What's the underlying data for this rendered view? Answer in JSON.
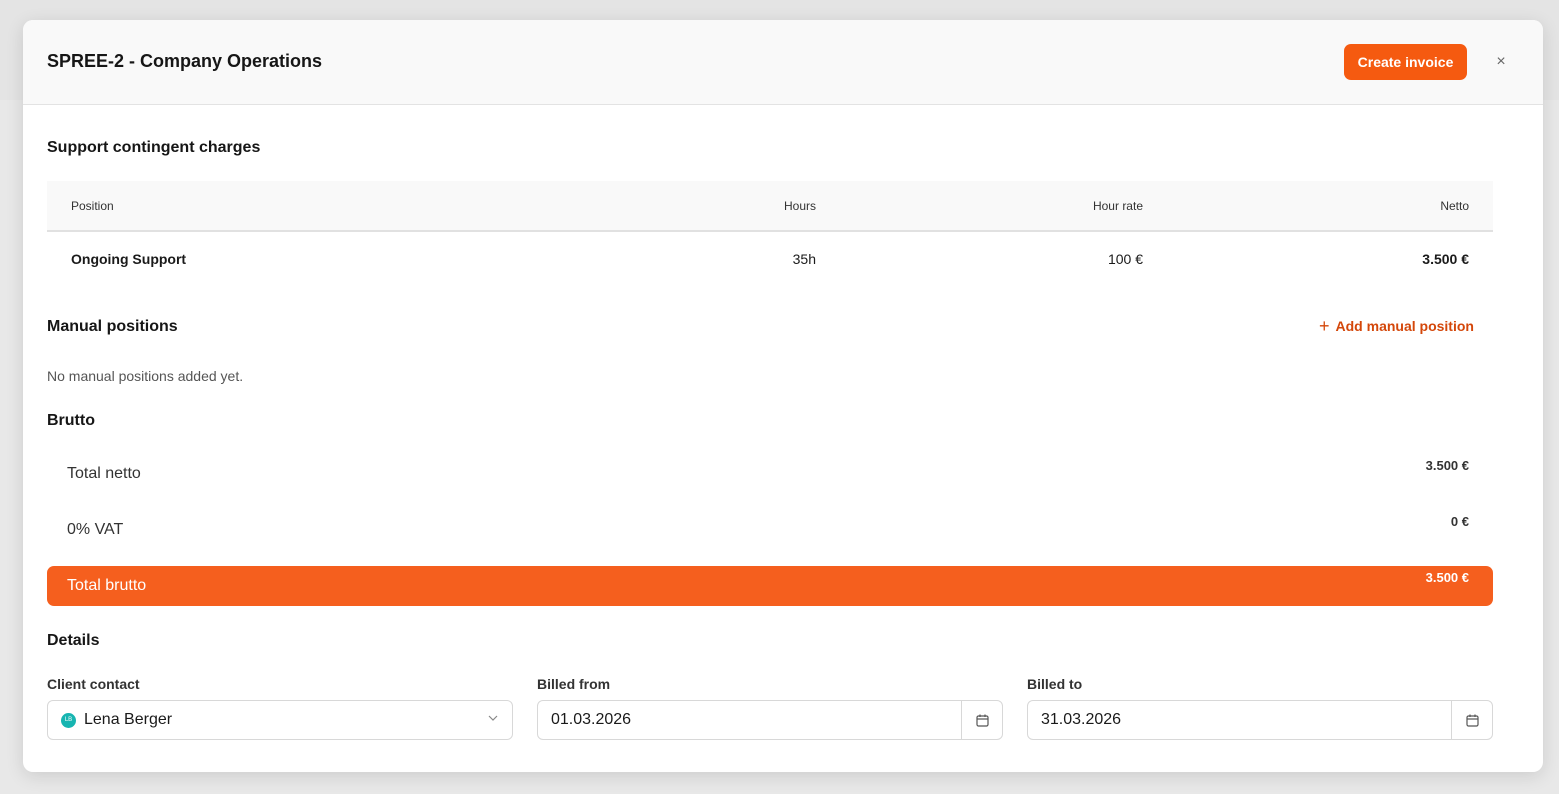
{
  "modal": {
    "title": "SPREE-2 - Company Operations",
    "create_invoice_label": "Create invoice",
    "close_label": "×"
  },
  "support": {
    "title": "Support contingent charges",
    "columns": [
      "Position",
      "Hours",
      "Hour rate",
      "Netto"
    ],
    "rows": [
      {
        "position": "Ongoing Support",
        "hours": "35h",
        "rate": "100 €",
        "netto": "3.500 €"
      }
    ]
  },
  "manual": {
    "title": "Manual positions",
    "add_label": "Add manual position",
    "add_icon": "plus-icon",
    "empty_text": "No manual positions added yet."
  },
  "brutto": {
    "title": "Brutto",
    "total_netto_label": "Total netto",
    "total_netto_value": "3.500 €",
    "vat_label": "0% VAT",
    "vat_value": "0 €",
    "total_brutto_label": "Total brutto",
    "total_brutto_value": "3.500 €"
  },
  "details": {
    "title": "Details",
    "client_contact_label": "Client contact",
    "client_contact_value": "Lena Berger",
    "client_contact_initials": "LB",
    "billed_from_label": "Billed from",
    "billed_from_value": "01.03.2026",
    "billed_to_label": "Billed to",
    "billed_to_value": "31.03.2026"
  },
  "colors": {
    "accent": "#f55a10",
    "total_bar": "#f55f1e",
    "link": "#d4470a",
    "avatar": "#17b5b1"
  }
}
